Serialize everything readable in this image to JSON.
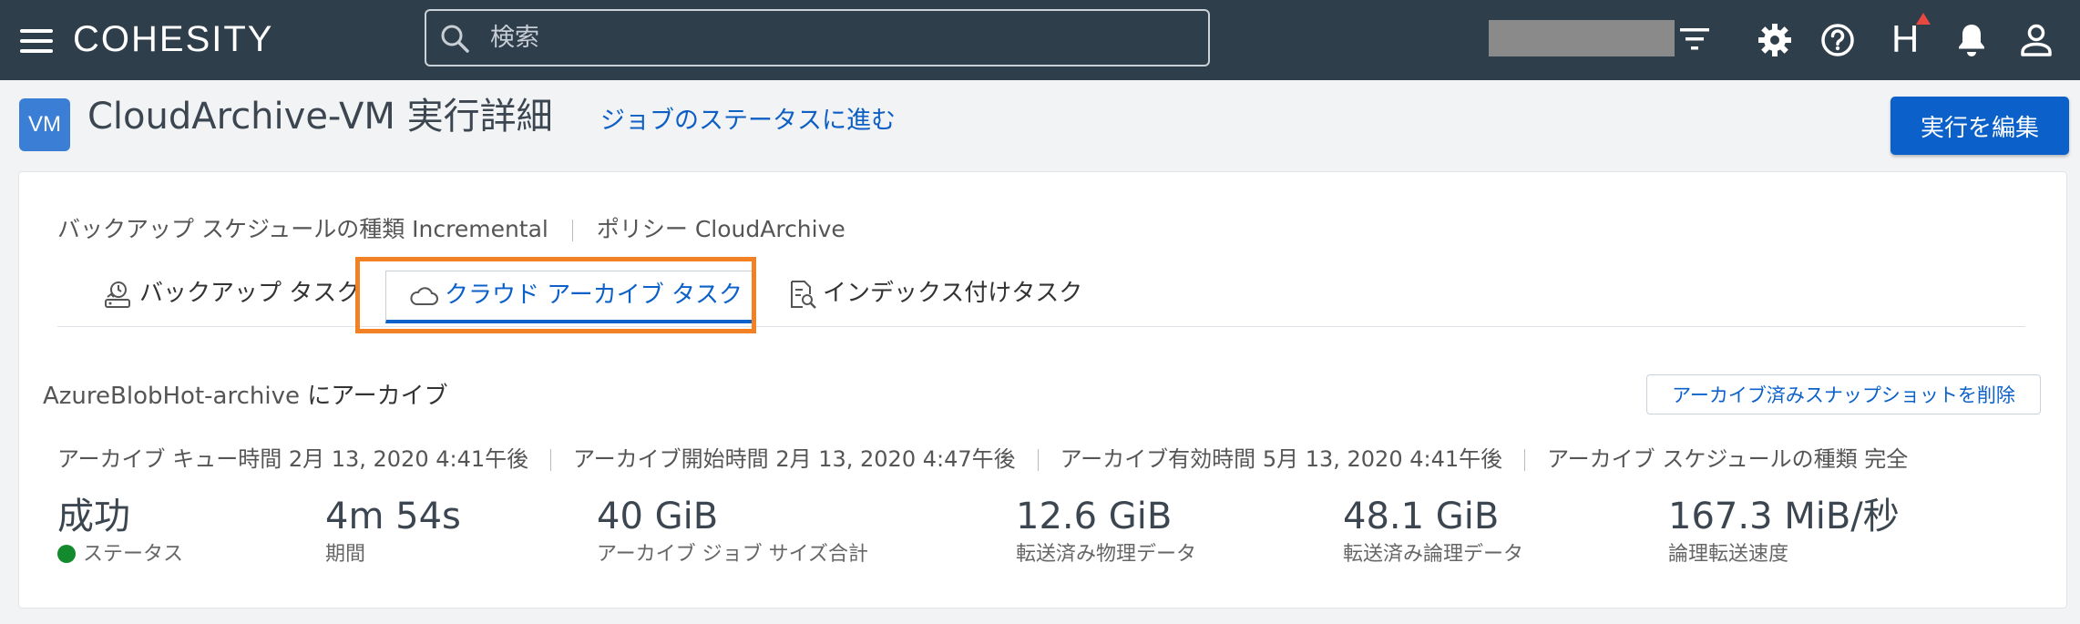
{
  "nav": {
    "logo": "COHESITY",
    "search_placeholder": "検索"
  },
  "header": {
    "vm_badge": "VM",
    "title": "CloudArchive-VM 実行詳細",
    "job_status_link": "ジョブのステータスに進む",
    "edit_button": "実行を編集",
    "h_label": "H"
  },
  "meta": {
    "schedule_type": "バックアップ スケジュールの種類 Incremental",
    "policy": "ポリシー CloudArchive"
  },
  "tabs": [
    {
      "label": "バックアップ タスク",
      "icon": "backup-restore-icon",
      "active": false
    },
    {
      "label": "クラウド アーカイブ タスク",
      "icon": "cloud-icon",
      "active": true
    },
    {
      "label": "インデックス付けタスク",
      "icon": "index-search-icon",
      "active": false
    }
  ],
  "archive": {
    "target_name": "AzureBlobHot-archive",
    "target_suffix": " にアーカイブ",
    "delete_button": "アーカイブ済みスナップショットを削除",
    "queue_time": "アーカイブ キュー時間 2月 13, 2020 4:41午後",
    "start_time": "アーカイブ開始時間 2月 13, 2020 4:47午後",
    "expiry_time": "アーカイブ有効時間 5月 13, 2020 4:41午後",
    "schedule_type": "アーカイブ スケジュールの種類 完全"
  },
  "stats": [
    {
      "value": "成功",
      "label": "ステータス"
    },
    {
      "value": "4m 54s",
      "label": "期間"
    },
    {
      "value": "40 GiB",
      "label": "アーカイブ ジョブ サイズ合計"
    },
    {
      "value": "12.6 GiB",
      "label": "転送済み物理データ"
    },
    {
      "value": "48.1 GiB",
      "label": "転送済み論理データ"
    },
    {
      "value": "167.3 MiB/秒",
      "label": "論理転送速度"
    }
  ],
  "colors": {
    "nav_bg": "#2f3e4b",
    "accent": "#0b61c9",
    "highlight": "#f28024",
    "success": "#128a2d",
    "alert": "#e8483f"
  }
}
